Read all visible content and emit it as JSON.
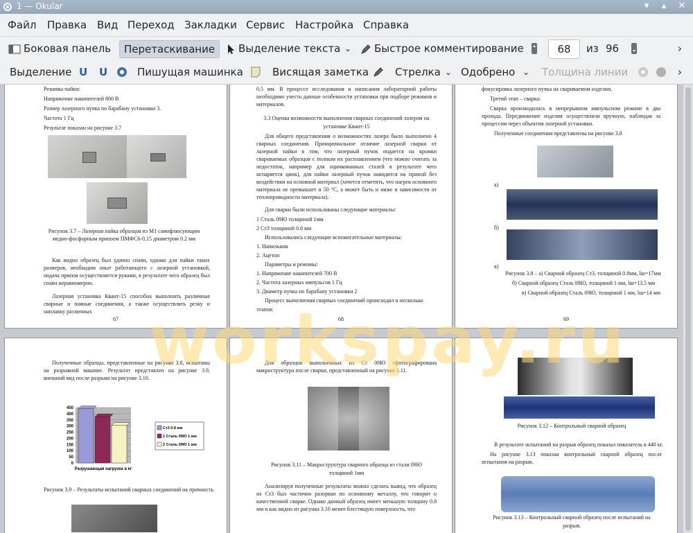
{
  "window": {
    "title": "1 — Okular"
  },
  "menu": [
    "Файл",
    "Правка",
    "Вид",
    "Переход",
    "Закладки",
    "Сервис",
    "Настройка",
    "Справка"
  ],
  "toolbar1": {
    "sidebar": "Боковая панель",
    "drag": "Перетаскивание",
    "text_select": "Выделение текста",
    "quick_comment": "Быстрое комментирование",
    "page_current": "68",
    "page_of": "из",
    "page_total": "96"
  },
  "toolbar2": {
    "selection": "Выделение",
    "typewriter": "Пишущая машинка",
    "sticky_note": "Висящая заметка",
    "arrow": "Стрелка",
    "approved": "Одобрено",
    "line_width": "Толщина линии"
  },
  "watermark": "workspay.ru",
  "pages": {
    "p67": {
      "lines": [
        "Режимы пайки:",
        "Напряжение накопителей 800 В",
        "Размер лазерного пучка по барабану установки 3.",
        "Частота 1 Гц",
        "Результат показан на рисунке 3.7"
      ],
      "caption1": "Рисунок 3.7 – Лазерная пайка образцов из М1 самофлюсующим",
      "caption2": "медно-фосфорным припоем ПМФС6-0,15 диаметром 0.2 мм",
      "para1": "Как видно образец был удачно спаян, однако для пайки таких размеров, необходим опыт работающего с лазерной установкой, подача припоя осуществляется руками, в результате чего образец был спаян неравномерно.",
      "para2": "Лазерная установка Квант-15 способна выполнить различные сварные и паяные соединения, а также осуществлять резку и наплавку различных",
      "num": "67"
    },
    "p68": {
      "top": "0.5 мм. В процессе исследования и написания лабораторной работы необходимо учесть данные особенности установки при подборе режимов и материалов.",
      "heading1": "3.3 Оценка возможности выполнения сварных соединений лазером на",
      "heading2": "установке Квант-15",
      "para": "Для общего представления о возможностях лазера было выполнено 4 сварных соединения. Принципиальное отличие лазерной сварки от лазерной пайки в том, что лазерный пучок подается на кромки свариваемых образцов с полным их расплавлением (что можно считать за недостаток, например для оцинкованных сталей в результате чего испаряется цинк), для пайки лазерный пучок наводится на припой без воздействия на основной материал (хочется отметить, что нагрев основного материала не превышает и 50 °С, а может быть и ниже в зависимости от теплопроводности материала).",
      "list_title": "Для сварки были использованы следующие материалы:",
      "items": [
        "1   Сталь 09Ю толщиной 1мм",
        "2   Ст3 толщиной 0.8 мм",
        "Использовались следующие вспомогательные материалы:",
        "1.  Напильник",
        "2.  Ацетон",
        "Параметры и режимы:",
        "1.  Напряжение накопителей 700 В",
        "2.  Частота лазерных импульсов 1 Гц",
        "3.  Диаметр пучка по барабану установки 2",
        "Процесс выполнения сварных соединений происходил в несколько",
        "этапов:"
      ],
      "num": "68"
    },
    "p69": {
      "top": "фокусировка лазерного пучка на свариваемом изделии.",
      "stage": "Третий этап – сварка:",
      "para": "Сварка производилась в непрерывном импульсном режиме в два прохода. Передвижение изделия осуществляли вручную, наблюдая за процессом через объектив лазерной установки.",
      "joints": "Полученные соединения представлены на рисунке 3.8",
      "label_a": "а)",
      "label_b": "б)",
      "label_c": "в)",
      "cap1": "Рисунок 3.8 – а) Сварной образец Ст3, толщиной 0.8мм, lш=17мм",
      "cap2": "б) Сварной образец Сталь 09Ю, толщиной 1 мм, lш=13.5 мм",
      "cap3": "в) Сварной образец Сталь 09Ю, толщиной 1 мм, lш=14 мм",
      "num": "69"
    },
    "p70": {
      "para": "Полученные образцы, представленные на рисунке 3.8, испытаны на разрывной машине. Результат представлен на рисунке 3.9, внешний вид после разрыва на рисунке 3.10.",
      "caption": "Рисунок 3.9 – Результаты испытаний сварных соединений на прочность"
    },
    "p71": {
      "para": "Для образцов выполненных из Ст 09Ю сфотографирована макроструктура после сварки, представленный на рисунке 3.11.",
      "cap1": "Рисунок 3.11 – Макроструктура сварного образца из стали 09Ю",
      "cap2": "толщиной 1мм",
      "para2": "Анализируя полученные результаты можно сделать вывод, что образец из Ст3 был частично разорван по основному металлу, что говорит о качественной сварке. Однако данный образец имеет меньшую толщину 0.8 мм и как видно из рисунка 3.10 менее блестящую поверхность, что"
    },
    "p72": {
      "cap12": "Рисунок 3.12 – Контрольный сварной образец",
      "para1": "В результате испытаний на разрыв образец показал показатель в 440 кг.",
      "para2": "На рисунке 3.13 показан контрольный сварной образец после испытания на разрыв.",
      "cap13a": "Рисунок 3.13 – Контрольный сварной образец после испытаний на",
      "cap13b": "разрыв."
    }
  },
  "chart_data": {
    "type": "bar",
    "categories": [
      "Разрушающая нагрузка в кг"
    ],
    "series": [
      {
        "name": "Ст3 0.8 мм",
        "values": [
          440
        ],
        "color": "#9a9ad8"
      },
      {
        "name": "1 Сталь 09Ю 1 мм",
        "values": [
          375
        ],
        "color": "#8e2855"
      },
      {
        "name": "2 Сталь 09Ю 1 мм",
        "values": [
          305
        ],
        "color": "#f6f2c2"
      }
    ],
    "xlabel": "Разрушающая нагрузка в кг",
    "yticks": [
      "0",
      "50",
      "100",
      "150",
      "200",
      "250",
      "300",
      "350",
      "400",
      "450"
    ],
    "ylim": [
      0,
      450
    ],
    "legend": "right"
  }
}
